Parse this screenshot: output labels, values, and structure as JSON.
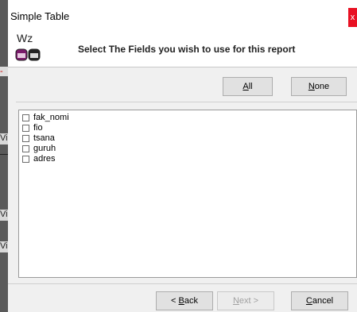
{
  "background_app": {
    "fragments": [
      "-",
      "Vi",
      "-",
      "Vi",
      "Vi"
    ]
  },
  "dialog": {
    "title": "Simple Table",
    "close_label": "x"
  },
  "header": {
    "logo_text": "Wz",
    "instruction": "Select The Fields you wish to use for this report"
  },
  "buttons": {
    "all": {
      "mnemonic": "A",
      "rest": "ll"
    },
    "none": {
      "mnemonic": "N",
      "rest": "one"
    },
    "back": {
      "prefix": "< ",
      "mnemonic": "B",
      "rest": "ack"
    },
    "next": {
      "mnemonic": "N",
      "rest": "ext >",
      "disabled": true
    },
    "cancel": {
      "mnemonic": "C",
      "rest": "ancel"
    }
  },
  "fields": [
    {
      "label": "fak_nomi",
      "checked": false
    },
    {
      "label": "fio",
      "checked": false
    },
    {
      "label": "tsana",
      "checked": false
    },
    {
      "label": "guruh",
      "checked": false
    },
    {
      "label": "adres",
      "checked": false
    }
  ],
  "colors": {
    "close": "#e81123",
    "dialog_bg": "#f0f0f0",
    "logo_box": "#7a1a6a"
  }
}
